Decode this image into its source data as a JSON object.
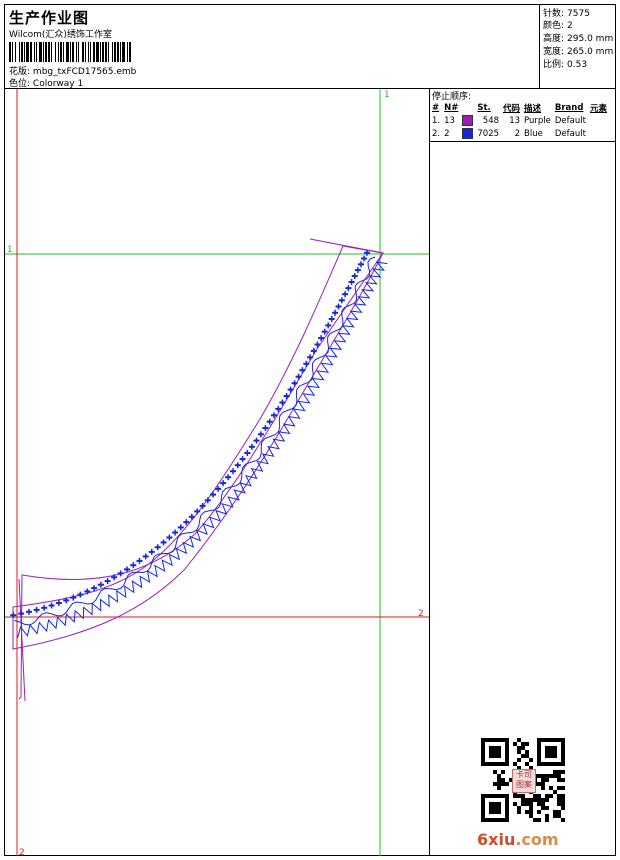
{
  "header": {
    "title": "生产作业图",
    "subtitle": "Wilcom(汇众)绣饰工作室",
    "filename_label": "花版:",
    "filename": "mbg_txFCD17565.emb",
    "colorway_label": "色位:",
    "colorway": "Colorway 1"
  },
  "stats": [
    {
      "label": "针数:",
      "value": "7575"
    },
    {
      "label": "颜色:",
      "value": "2"
    },
    {
      "label": "高度:",
      "value": "295.0 mm"
    },
    {
      "label": "宽度:",
      "value": "265.0 mm"
    },
    {
      "label": "比例:",
      "value": "0.53"
    }
  ],
  "stop_sequence": {
    "title": "停止顺序:",
    "headers": [
      "#",
      "N#",
      "St.",
      "代码",
      "描述",
      "Brand",
      "元素"
    ],
    "rows": [
      {
        "num": "1.",
        "n": "13",
        "color": "#9b1fb5",
        "st": "548",
        "code": "13",
        "desc": "Purple",
        "brand": "Default"
      },
      {
        "num": "2.",
        "n": "2",
        "color": "#1428e0",
        "st": "7025",
        "code": "2",
        "desc": "Blue",
        "brand": "Default"
      }
    ]
  },
  "guides": {
    "v1": "1",
    "h1": "1",
    "h2": "2",
    "v2": "2"
  },
  "colors": {
    "outline": "#9b1fb5",
    "stitch": "#1428e0",
    "guide_green": "#22c022",
    "guide_red": "#e01818"
  },
  "logo": {
    "main": "6xiu",
    "rest": ".com"
  },
  "seal": "卡司图案"
}
